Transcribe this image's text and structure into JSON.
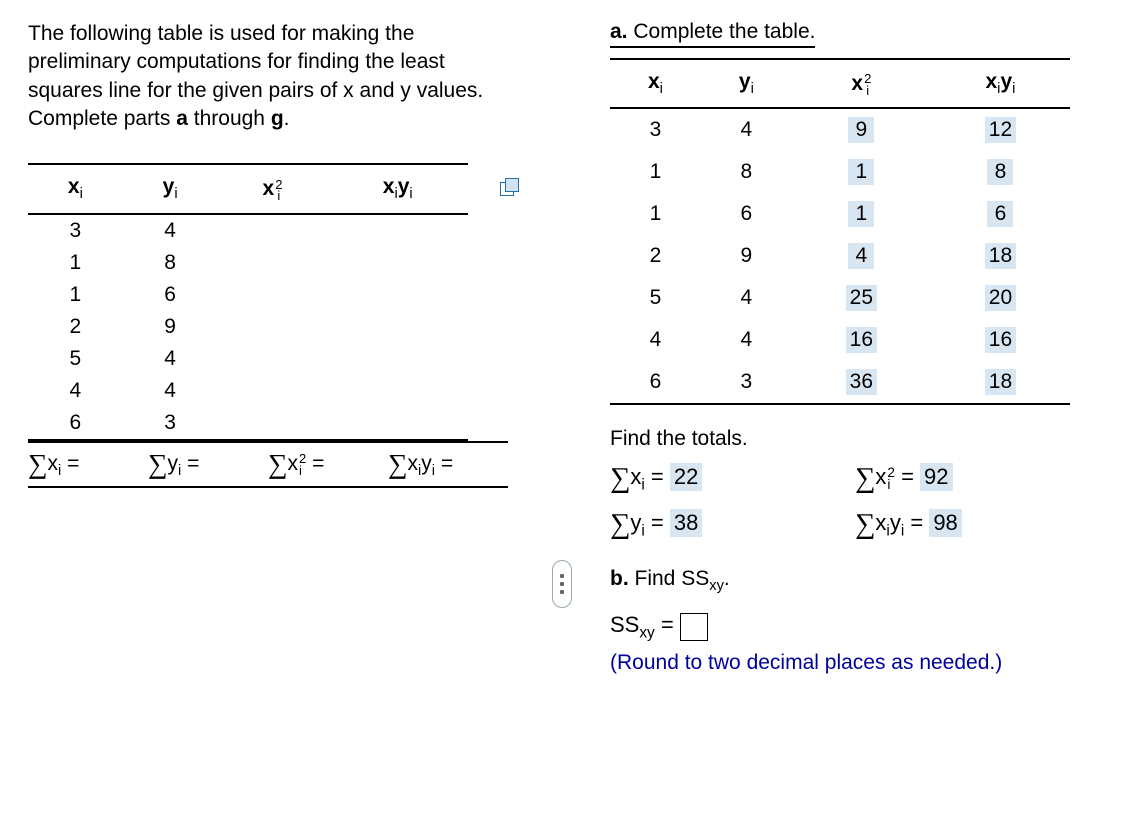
{
  "left": {
    "prompt": "The following table is used for making the preliminary computations for finding the least squares line for the given pairs of x and y values. Complete parts ",
    "prompt_bold1": "a",
    "prompt_mid": " through ",
    "prompt_bold2": "g",
    "prompt_end": ".",
    "headers": {
      "xi": "x",
      "yi": "y",
      "xi2_base": "x",
      "xiyi_a": "x",
      "xiyi_b": "y"
    },
    "rows": [
      {
        "x": "3",
        "y": "4"
      },
      {
        "x": "1",
        "y": "8"
      },
      {
        "x": "1",
        "y": "6"
      },
      {
        "x": "2",
        "y": "9"
      },
      {
        "x": "5",
        "y": "4"
      },
      {
        "x": "4",
        "y": "4"
      },
      {
        "x": "6",
        "y": "3"
      }
    ],
    "sums": {
      "sx": "=",
      "sy": "=",
      "sx2": "=",
      "sxy": "="
    }
  },
  "right": {
    "part_a_label": "a.",
    "part_a_text": " Complete the table.",
    "rows": [
      {
        "x": "3",
        "y": "4",
        "x2": "9",
        "xy": "12"
      },
      {
        "x": "1",
        "y": "8",
        "x2": "1",
        "xy": "8"
      },
      {
        "x": "1",
        "y": "6",
        "x2": "1",
        "xy": "6"
      },
      {
        "x": "2",
        "y": "9",
        "x2": "4",
        "xy": "18"
      },
      {
        "x": "5",
        "y": "4",
        "x2": "25",
        "xy": "20"
      },
      {
        "x": "4",
        "y": "4",
        "x2": "16",
        "xy": "16"
      },
      {
        "x": "6",
        "y": "3",
        "x2": "36",
        "xy": "18"
      }
    ],
    "find_totals": "Find the totals.",
    "totals": {
      "sx": "22",
      "sx2": "92",
      "sy": "38",
      "sxy": "98"
    },
    "part_b_label": "b.",
    "part_b_text": " Find SS",
    "part_b_sub": "xy",
    "part_b_end": ".",
    "ssxy_label_a": "SS",
    "ssxy_label_sub": "xy",
    "ssxy_eq": " = ",
    "note": "(Round to two decimal places as needed.)"
  }
}
